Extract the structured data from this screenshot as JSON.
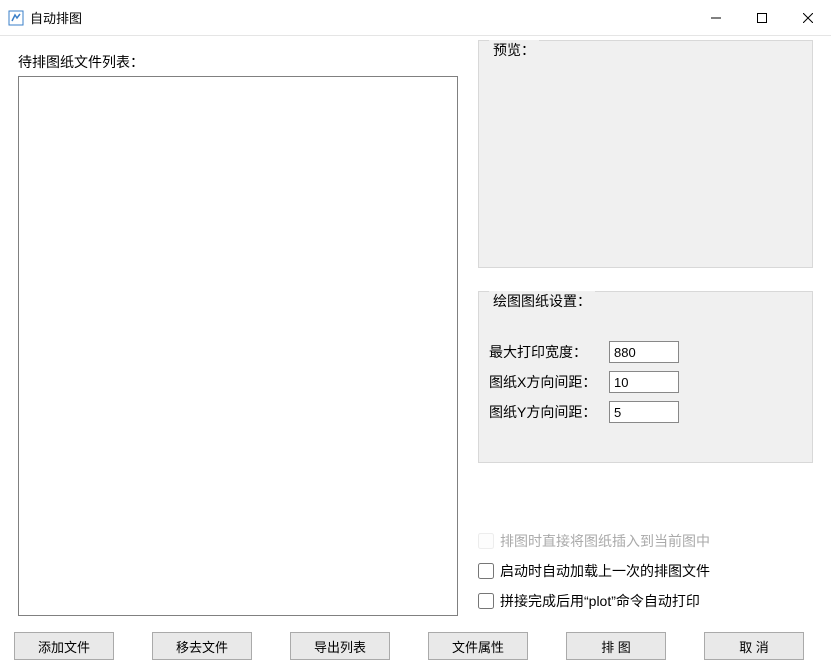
{
  "window": {
    "title": "自动排图"
  },
  "left_panel": {
    "file_list_label": "待排图纸文件列表："
  },
  "preview": {
    "legend": "预览："
  },
  "settings": {
    "legend": "绘图图纸设置：",
    "max_print_width_label": "最大打印宽度：",
    "max_print_width_value": "880",
    "x_spacing_label": "图纸X方向间距：",
    "x_spacing_value": "10",
    "y_spacing_label": "图纸Y方向间距：",
    "y_spacing_value": "5"
  },
  "options": {
    "insert_into_current": "排图时直接将图纸插入到当前图中",
    "load_last_on_start": "启动时自动加载上一次的排图文件",
    "auto_plot_after_merge": "拼接完成后用“plot”命令自动打印"
  },
  "buttons": {
    "add_file": "添加文件",
    "remove_file": "移去文件",
    "export_list": "导出列表",
    "file_props": "文件属性",
    "layout": "排  图",
    "cancel": "取  消"
  }
}
